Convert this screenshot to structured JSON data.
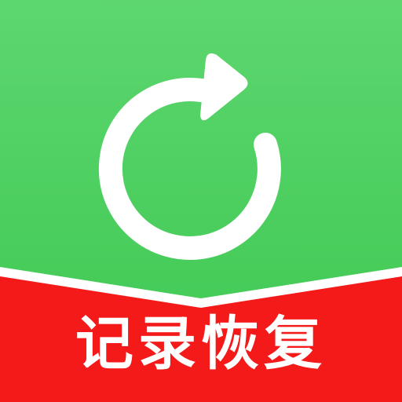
{
  "app_icon": {
    "icon": "refresh-arrow-icon",
    "banner_text": "记录恢复"
  },
  "colors": {
    "background_green_top": "#5dd66f",
    "background_green_bottom": "#3dc851",
    "banner_red": "#f41a1a",
    "banner_red_top": "#e60012",
    "highlight_white": "#ffffff"
  }
}
